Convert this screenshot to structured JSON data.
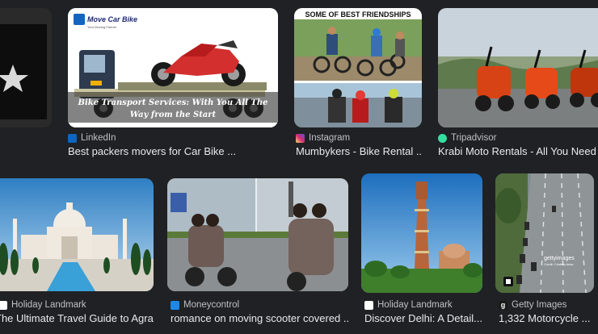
{
  "results": [
    {
      "source": "",
      "title": "",
      "favicon": "none"
    },
    {
      "source": "LinkedIn",
      "title": "Best packers movers for Car Bike ...",
      "favicon": "linkedin-icon",
      "favicon_color": "#0a66c2",
      "overlay_logo": "Move Car Bike",
      "overlay_tagline": "Your Moving Partner",
      "caption_line1": "Bike Transport Services: With You All The",
      "caption_line2": "Way from the Start"
    },
    {
      "source": "Instagram",
      "title": "Mumbykers - Bike Rental ...",
      "favicon": "instagram-icon",
      "favicon_color": "#d62976",
      "banner": "SOME OF BEST FRIENDSHIPS"
    },
    {
      "source": "Tripadvisor",
      "title": "Krabi Moto Rentals - All You Need to ...",
      "favicon": "tripadvisor-icon",
      "favicon_color": "#34e0a1"
    },
    {
      "source": "Holiday Landmark",
      "title": "The Ultimate Travel Guide to Agra ...",
      "favicon": "holiday-landmark-icon",
      "favicon_color": "#ffffff"
    },
    {
      "source": "Moneycontrol",
      "title": "romance on moving scooter covered ...",
      "favicon": "moneycontrol-icon",
      "favicon_color": "#1e88e5"
    },
    {
      "source": "Holiday Landmark",
      "title": "Discover Delhi: A Detail...",
      "favicon": "holiday-landmark-icon",
      "favicon_color": "#ffffff"
    },
    {
      "source": "Getty Images",
      "title": "1,332 Motorcycle ...",
      "favicon": "getty-icon",
      "favicon_color": "#ffffff",
      "watermark": "gettyimages",
      "credit": "Credit: Cristina Arias"
    }
  ]
}
